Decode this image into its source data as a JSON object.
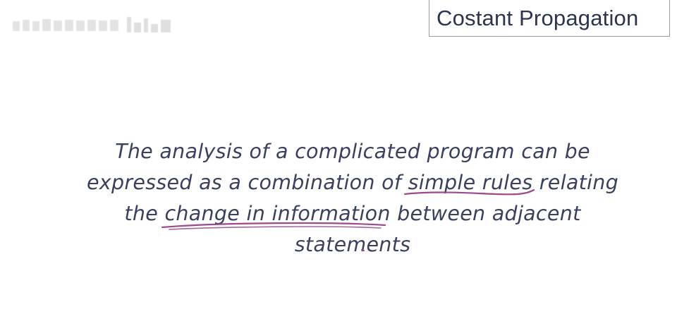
{
  "slide": {
    "title": "Costant Propagation",
    "lines": [
      "The analysis of a complicated program can be",
      "expressed as a combination of simple rules relating",
      "the change in information between adjacent",
      "statements"
    ]
  },
  "colors": {
    "text": "#3a4160",
    "title": "#2c3550",
    "ink": "#9b4a8c"
  }
}
